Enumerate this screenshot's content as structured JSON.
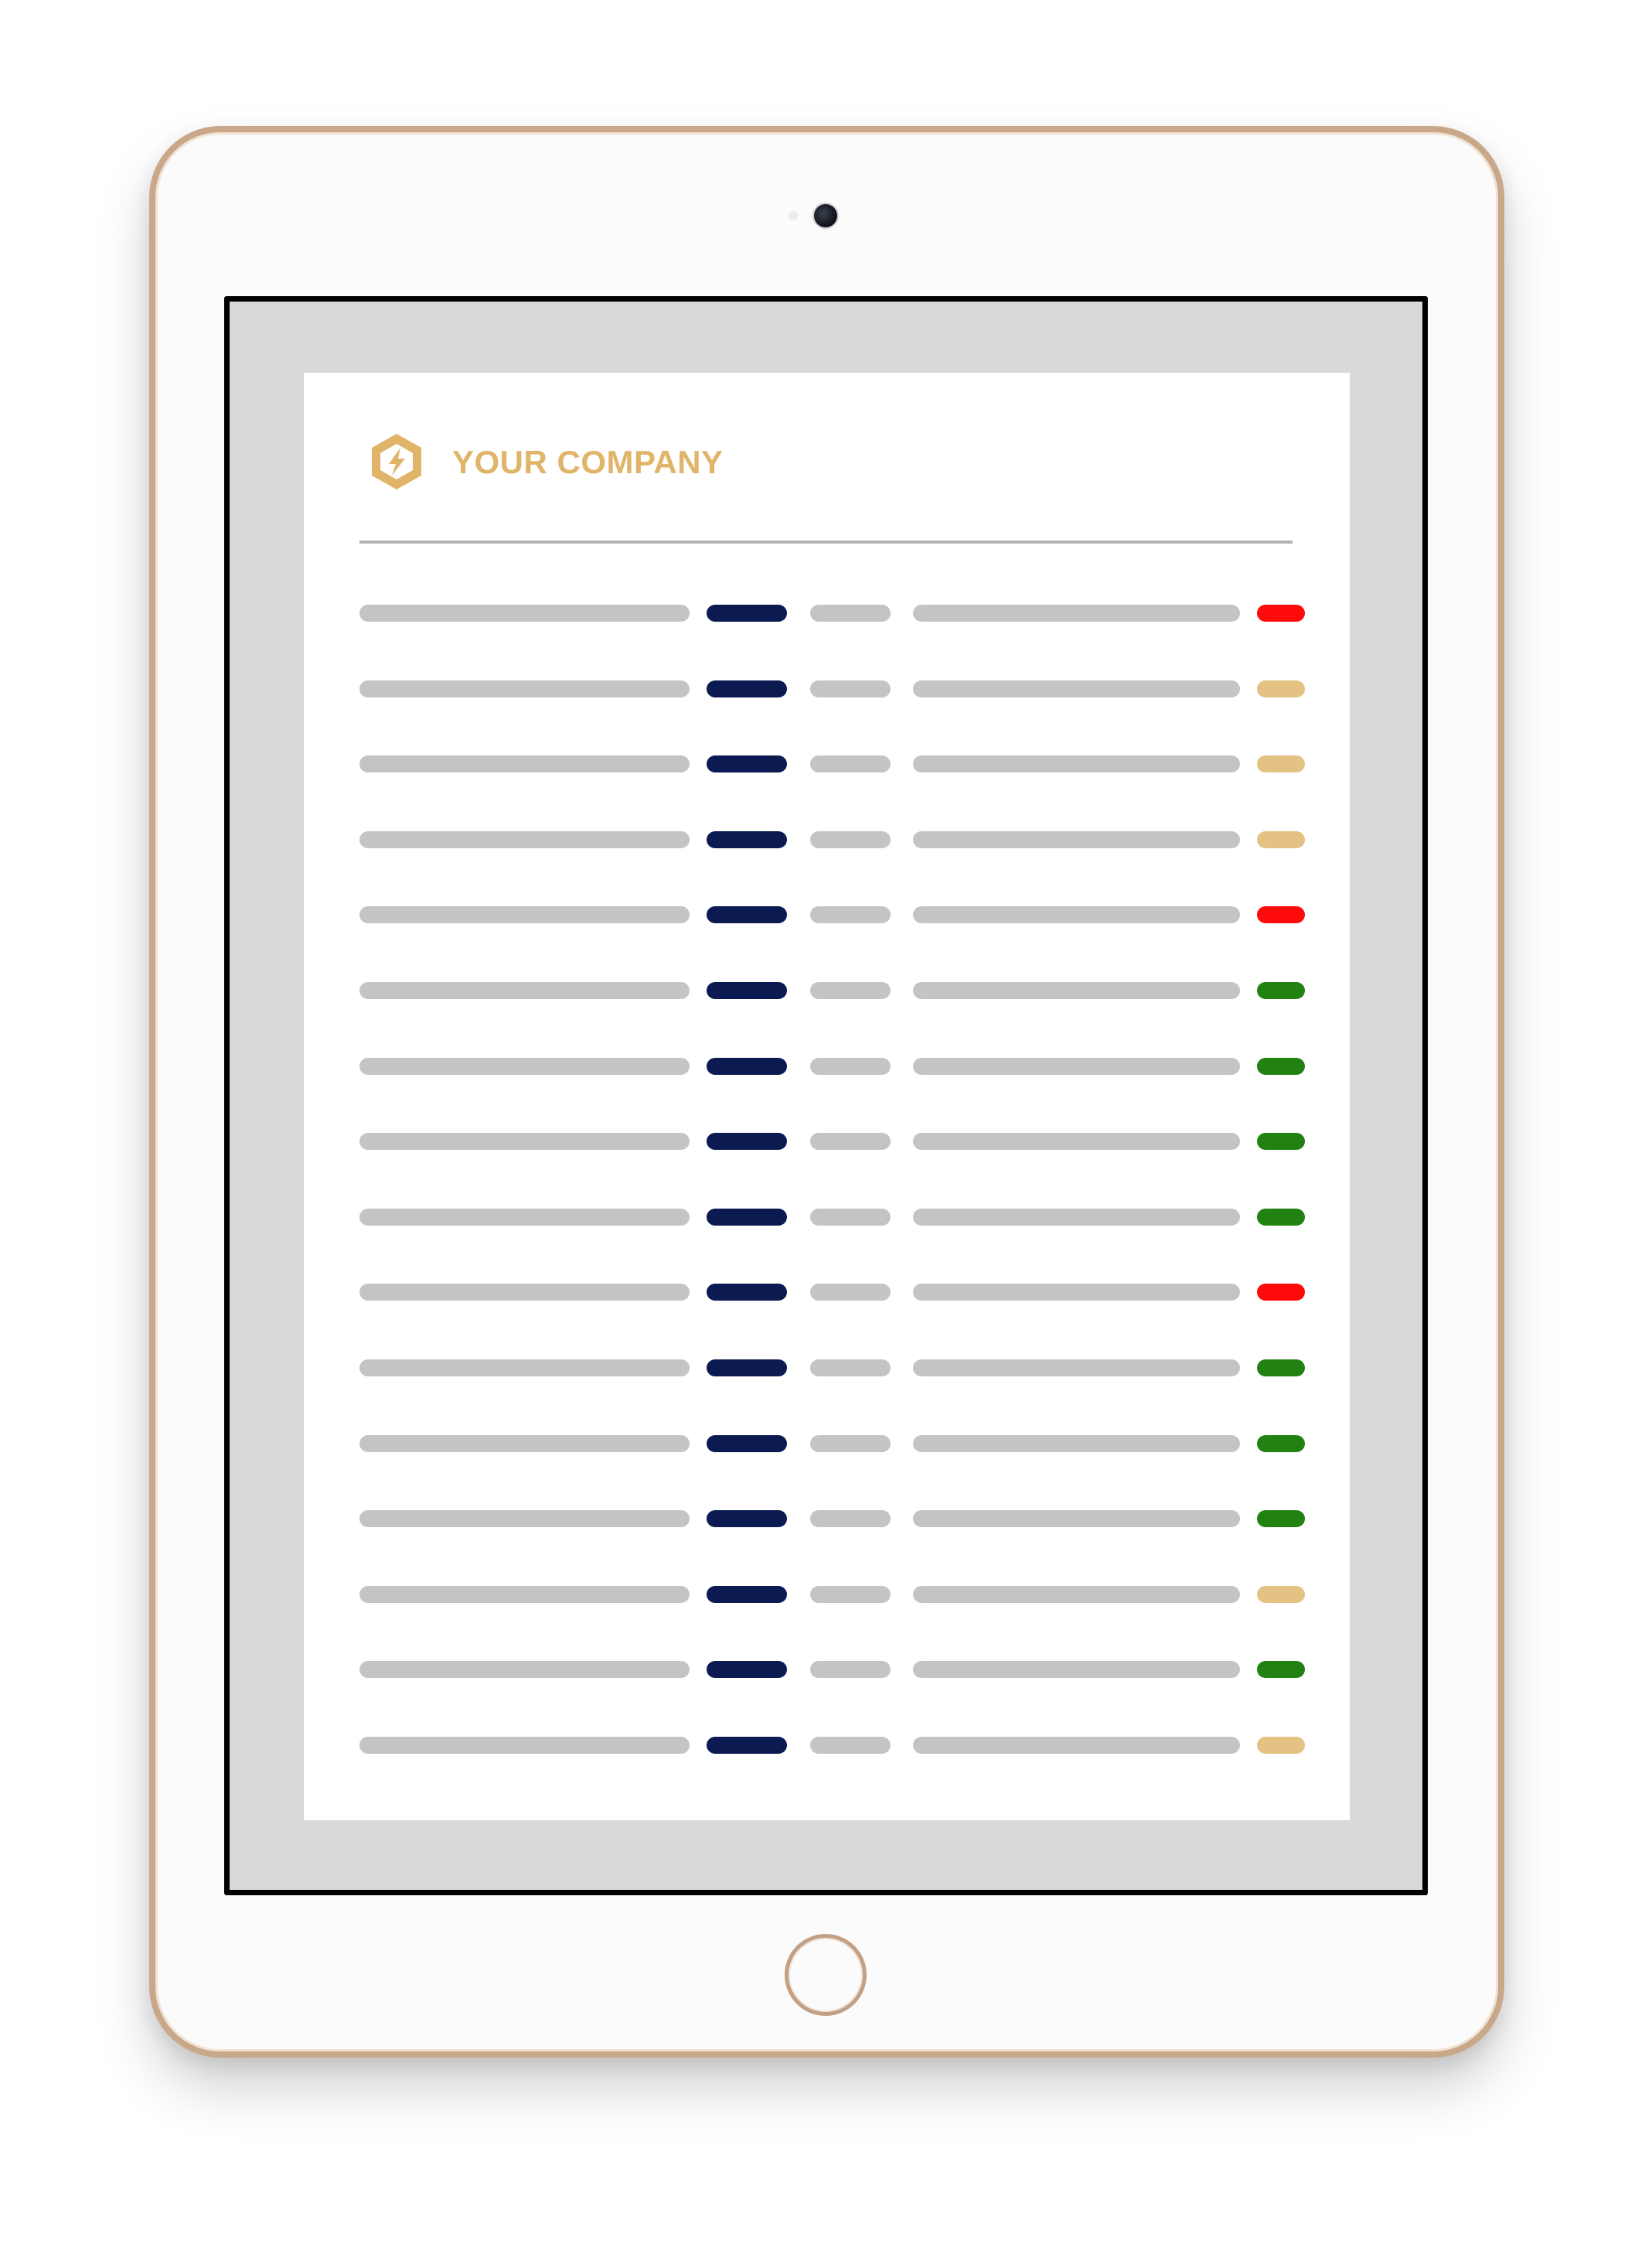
{
  "header": {
    "company_name": "YOUR COMPANY",
    "logo_icon": "lightning-hexagon-icon",
    "brand_color": "#e0b469"
  },
  "status_colors": {
    "red": "#ff0a0a",
    "tan": "#e3c283",
    "green": "#218212"
  },
  "rows": [
    {
      "status": "red"
    },
    {
      "status": "tan"
    },
    {
      "status": "tan"
    },
    {
      "status": "tan"
    },
    {
      "status": "red"
    },
    {
      "status": "green"
    },
    {
      "status": "green"
    },
    {
      "status": "green"
    },
    {
      "status": "green"
    },
    {
      "status": "red"
    },
    {
      "status": "green"
    },
    {
      "status": "green"
    },
    {
      "status": "green"
    },
    {
      "status": "tan"
    },
    {
      "status": "green"
    },
    {
      "status": "tan"
    }
  ]
}
